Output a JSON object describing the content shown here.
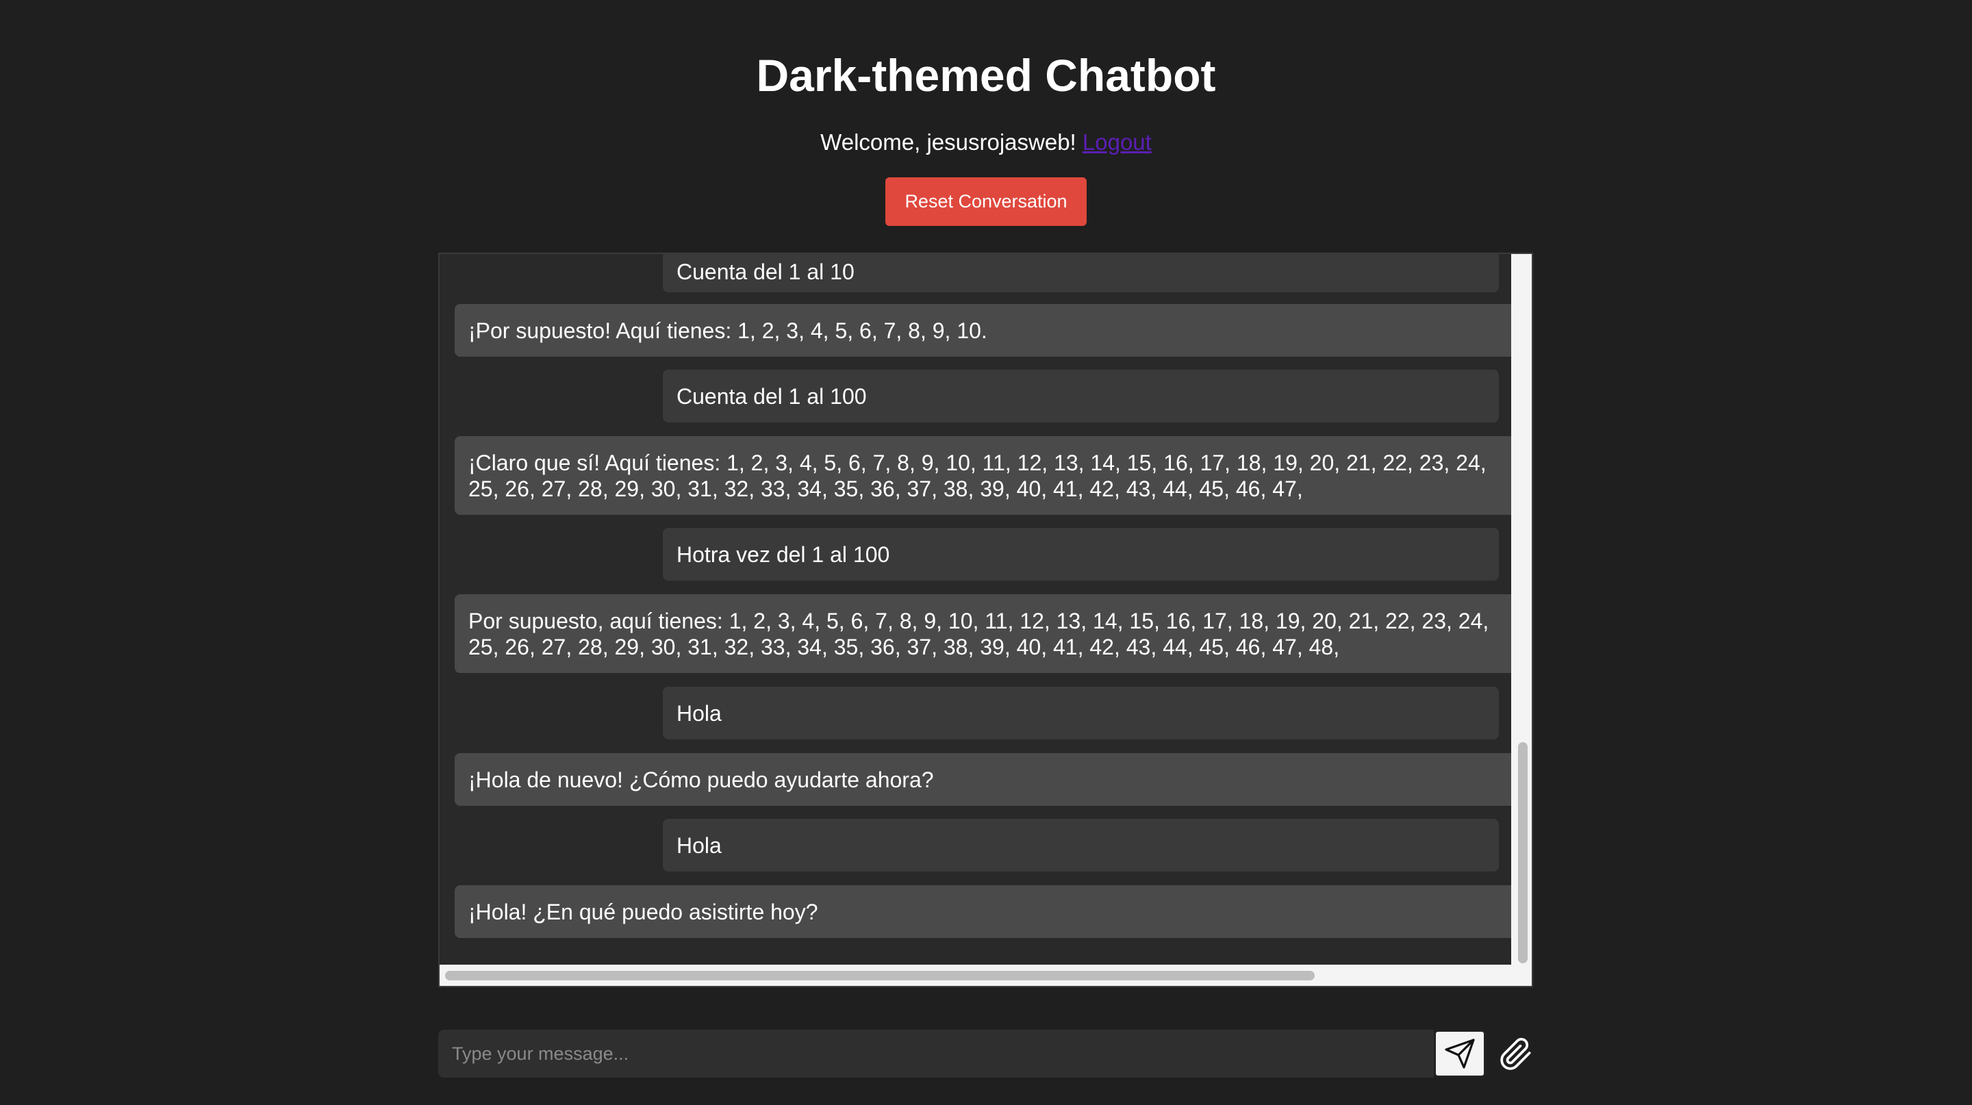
{
  "header": {
    "title": "Dark-themed Chatbot",
    "welcome_text": "Welcome, jesusrojasweb!",
    "logout_label": "Logout",
    "reset_label": "Reset Conversation"
  },
  "messages": [
    {
      "role": "user",
      "text": "Cuenta del 1 al 10"
    },
    {
      "role": "bot",
      "text": "¡Por supuesto! Aquí tienes: 1, 2, 3, 4, 5, 6, 7, 8, 9, 10."
    },
    {
      "role": "user",
      "text": "Cuenta del 1 al 100"
    },
    {
      "role": "bot",
      "text": "¡Claro que sí! Aquí tienes: 1, 2, 3, 4, 5, 6, 7, 8, 9, 10, 11, 12, 13, 14, 15, 16, 17, 18, 19, 20, 21, 22, 23, 24,\n25, 26, 27, 28, 29, 30, 31, 32, 33, 34, 35, 36, 37, 38, 39, 40, 41, 42, 43, 44, 45, 46, 47,"
    },
    {
      "role": "user",
      "text": "Hotra vez del 1 al 100"
    },
    {
      "role": "bot",
      "text": "Por supuesto, aquí tienes: 1, 2, 3, 4, 5, 6, 7, 8, 9, 10, 11, 12, 13, 14, 15, 16, 17, 18, 19, 20, 21, 22, 23, 24,\n25, 26, 27, 28, 29, 30, 31, 32, 33, 34, 35, 36, 37, 38, 39, 40, 41, 42, 43, 44, 45, 46, 47, 48,"
    },
    {
      "role": "user",
      "text": "Hola"
    },
    {
      "role": "bot",
      "text": "¡Hola de nuevo! ¿Cómo puedo ayudarte ahora?"
    },
    {
      "role": "user",
      "text": "Hola"
    },
    {
      "role": "bot",
      "text": "¡Hola! ¿En qué puedo asistirte hoy?"
    }
  ],
  "composer": {
    "placeholder": "Type your message...",
    "send_icon": "paper-plane-icon",
    "attach_icon": "paperclip-icon"
  },
  "colors": {
    "background": "#1f1f1f",
    "reset_button": "#e0483d",
    "user_bubble": "#3a3a3a",
    "bot_bubble": "#4a4a4a",
    "logout_link": "#5b1fb3"
  }
}
